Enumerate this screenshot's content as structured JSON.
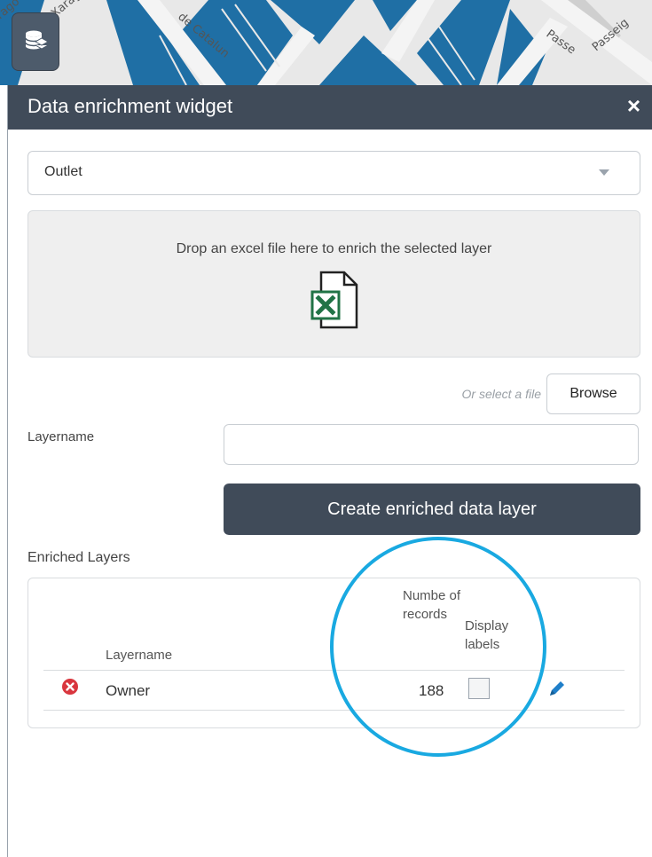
{
  "map": {
    "street_labels": [
      "Xarago",
      "de Catalun",
      "Passe",
      "Passeig",
      "rago"
    ],
    "colors": {
      "blocks": "#1f6fa5",
      "road": "#f4f4f4",
      "background": "#e8e8e8"
    },
    "tool_button_icon": "database-layers-icon"
  },
  "widget": {
    "title": "Data enrichment widget",
    "close_symbol": "×",
    "layer_select": {
      "value": "Outlet"
    },
    "drop_zone": {
      "text": "Drop an excel file here to enrich the selected layer",
      "icon": "excel-file-icon"
    },
    "file_select": {
      "hint": "Or select a file",
      "browse_label": "Browse"
    },
    "layername_label": "Layername",
    "layername_input": {
      "value": "",
      "placeholder": ""
    },
    "create_button_label": "Create enriched data layer",
    "enriched_heading": "Enriched Layers",
    "table": {
      "headers": {
        "layername": "Layername",
        "records": "Numbe of records",
        "display": "Display labels"
      },
      "rows": [
        {
          "layername": "Owner",
          "records": "188",
          "display_labels": false
        }
      ]
    },
    "colors": {
      "header_bg": "#404b59",
      "highlight": "#19a9e1",
      "remove": "#d9363e",
      "edit": "#1f7fc9"
    }
  }
}
